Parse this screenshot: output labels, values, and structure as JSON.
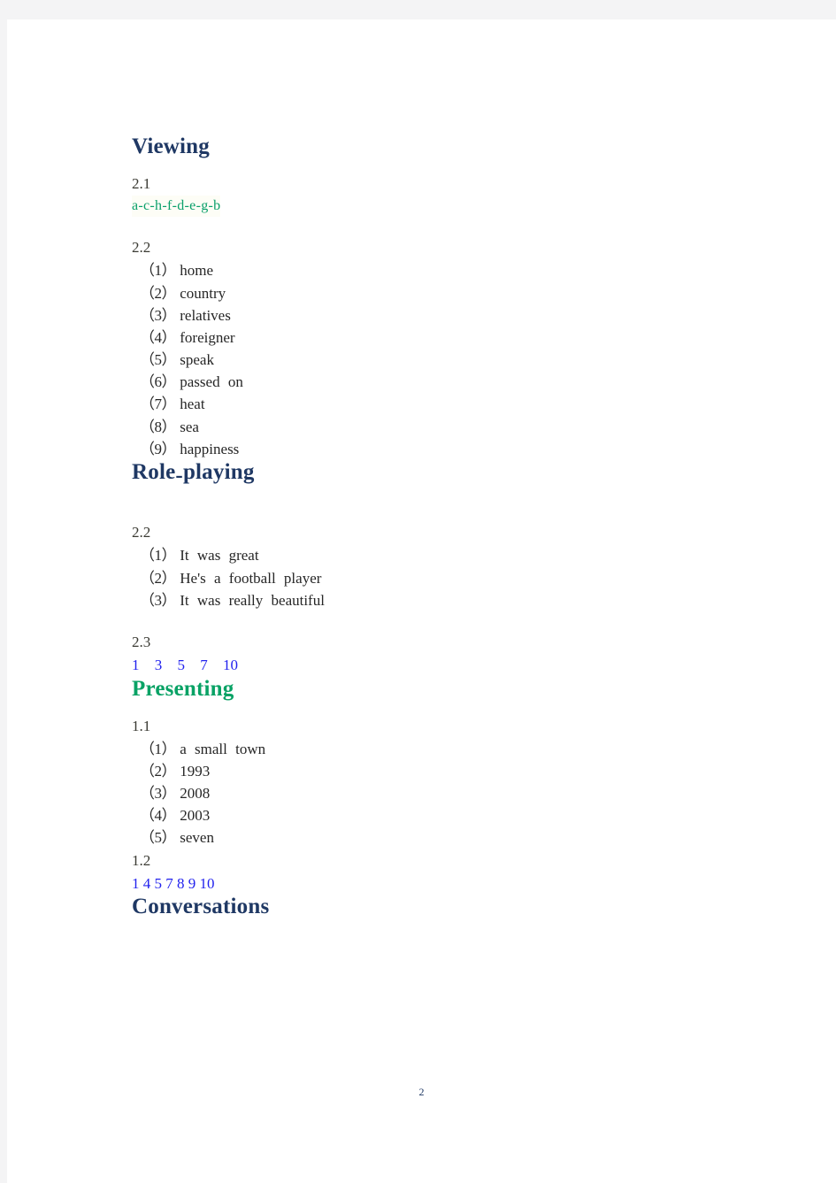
{
  "document": {
    "page_number": "2",
    "colors": {
      "heading_navy": "#1f3864",
      "heading_green": "#08a265",
      "answer_green": "#0aa06a",
      "answer_blue": "#2222ee",
      "body_text": "#262626",
      "canvas_gray": "#f4f4f5",
      "page_white": "#ffffff"
    }
  },
  "sections": [
    {
      "heading": "Viewing",
      "heading_color": "navy",
      "blocks": [
        {
          "label": "2.1",
          "type": "inline_answer",
          "answer": "a-c-h-f-d-e-g-b",
          "style": "green"
        },
        {
          "label": "2.2",
          "type": "numbered_list",
          "items": [
            {
              "marker": "（1）",
              "text": "home"
            },
            {
              "marker": "（2）",
              "text": "country"
            },
            {
              "marker": "（3）",
              "text": "relatives"
            },
            {
              "marker": "（4）",
              "text": "foreigner"
            },
            {
              "marker": "（5）",
              "text": "speak"
            },
            {
              "marker": "（6）",
              "text": "passed on"
            },
            {
              "marker": "（7）",
              "text": "heat"
            },
            {
              "marker": "（8）",
              "text": "sea"
            },
            {
              "marker": "（9）",
              "text": "happiness"
            }
          ]
        }
      ]
    },
    {
      "heading_part1": "Role",
      "heading_hyphen": "-",
      "heading_part2": "playing",
      "heading_color": "navy",
      "blocks": [
        {
          "label": "2.2",
          "type": "numbered_list",
          "items": [
            {
              "marker": "（1）",
              "text": "It was great"
            },
            {
              "marker": "（2）",
              "text": "He's a football player"
            },
            {
              "marker": "（3）",
              "text": "It was really beautiful"
            }
          ]
        },
        {
          "label": "2.3",
          "type": "inline_answer",
          "answer": "1  3  5  7  10",
          "style": "blue_spaced"
        }
      ]
    },
    {
      "heading": "Presenting",
      "heading_color": "green",
      "blocks": [
        {
          "label": "1.1",
          "type": "numbered_list",
          "items": [
            {
              "marker": "（1）",
              "text": "a small town"
            },
            {
              "marker": "（2）",
              "text": "1993"
            },
            {
              "marker": "（3）",
              "text": "2008"
            },
            {
              "marker": "（4）",
              "text": "2003"
            },
            {
              "marker": "（5）",
              "text": "seven"
            }
          ]
        },
        {
          "label": "1.2",
          "type": "inline_answer",
          "answer": "1 4 5 7 8 9 10",
          "style": "blue"
        }
      ]
    },
    {
      "heading": "Conversations",
      "heading_color": "navy",
      "blocks": []
    }
  ]
}
